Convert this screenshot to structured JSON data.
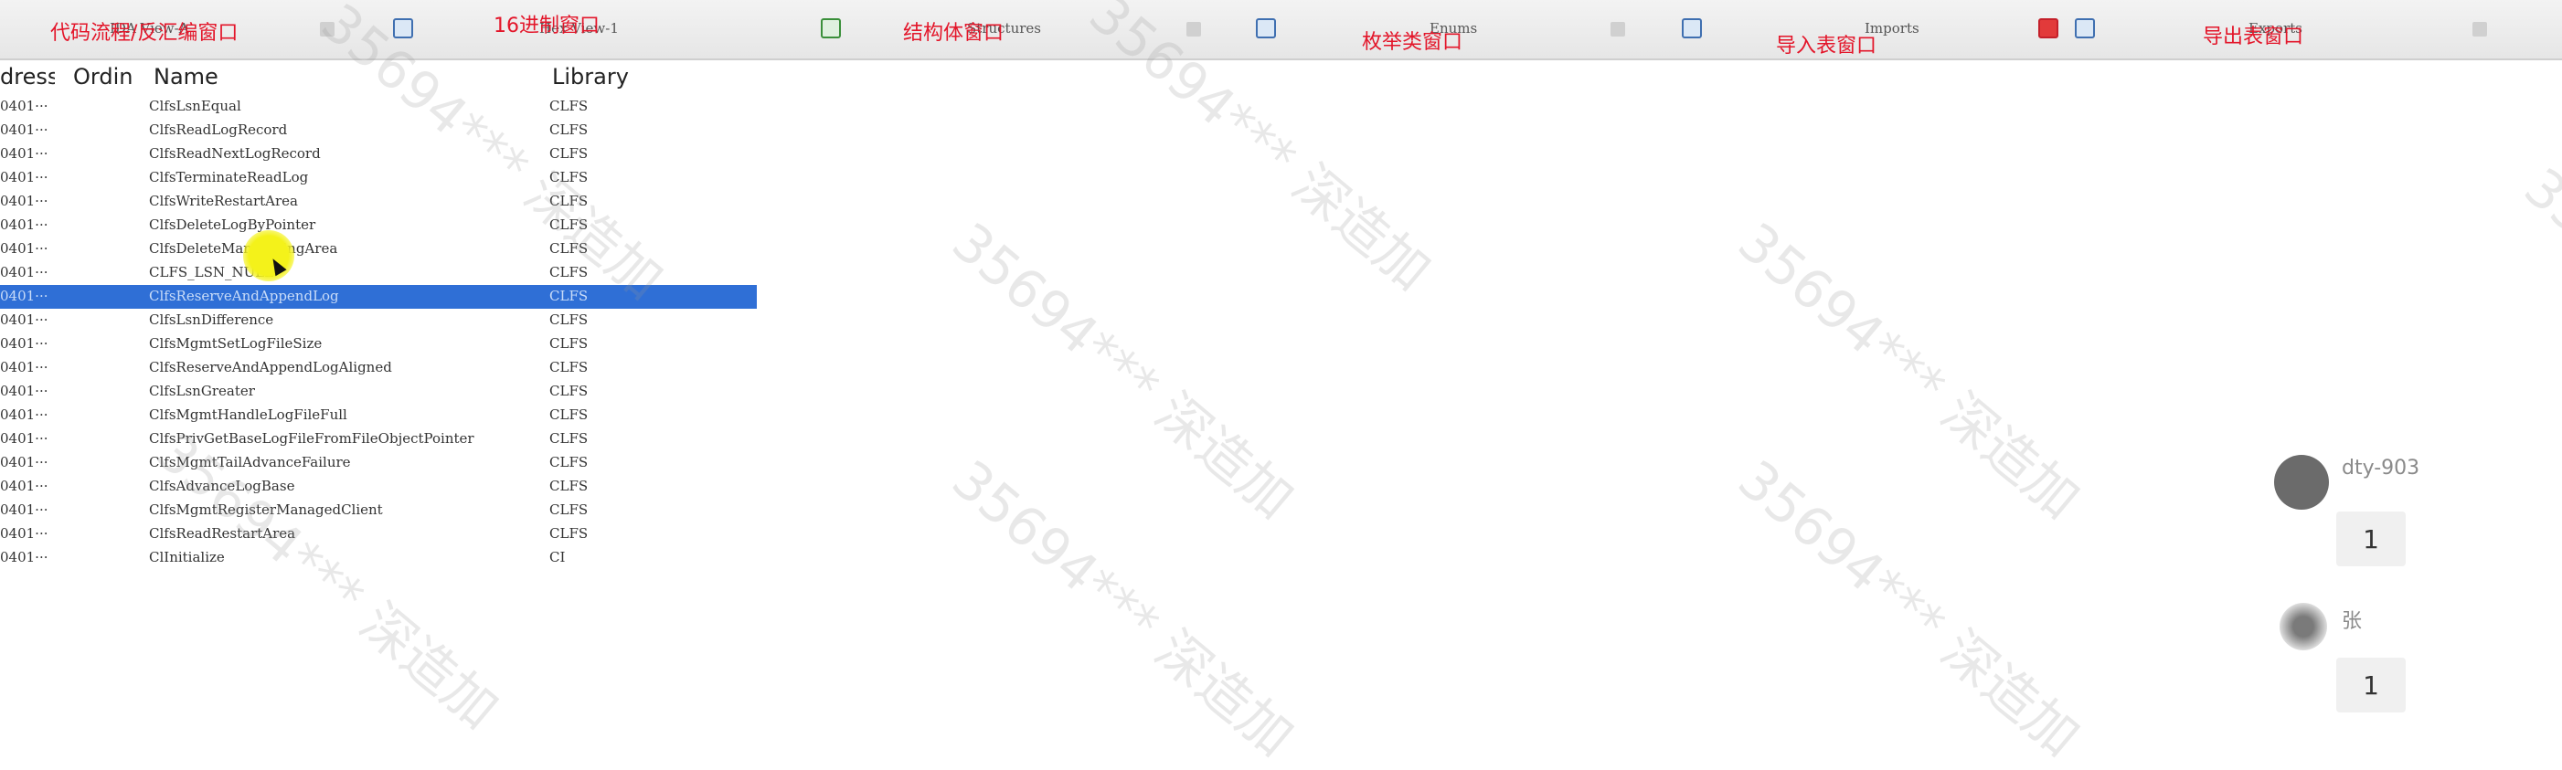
{
  "annotations": [
    "代码流程/反汇编窗口",
    "16进制窗口",
    "结构体窗口",
    "枚举类窗口",
    "导入表窗口",
    "导出表窗口"
  ],
  "tabs": [
    {
      "label": "IDA View-A",
      "icon": "code-view-icon"
    },
    {
      "label": "Hex View-1",
      "icon": "hex-view-icon"
    },
    {
      "label": "Structures",
      "icon": "structures-icon"
    },
    {
      "label": "Enums",
      "icon": "enums-icon"
    },
    {
      "label": "Imports",
      "icon": "imports-icon"
    },
    {
      "label": "Exports",
      "icon": "exports-icon"
    }
  ],
  "list": {
    "columns": [
      "dress",
      "Ordin",
      "Name",
      "Library"
    ],
    "rows": [
      {
        "address": "0401···",
        "name": "ClfsLsnEqual",
        "library": "CLFS"
      },
      {
        "address": "0401···",
        "name": "ClfsReadLogRecord",
        "library": "CLFS"
      },
      {
        "address": "0401···",
        "name": "ClfsReadNextLogRecord",
        "library": "CLFS"
      },
      {
        "address": "0401···",
        "name": "ClfsTerminateReadLog",
        "library": "CLFS"
      },
      {
        "address": "0401···",
        "name": "ClfsWriteRestartArea",
        "library": "CLFS"
      },
      {
        "address": "0401···",
        "name": "ClfsDeleteLogByPointer",
        "library": "CLFS"
      },
      {
        "address": "0401···",
        "name": "ClfsDeleteMarshallingArea",
        "library": "CLFS"
      },
      {
        "address": "0401···",
        "name": "CLFS_LSN_NULL",
        "library": "CLFS"
      },
      {
        "address": "0401···",
        "name": "ClfsReserveAndAppendLog",
        "library": "CLFS"
      },
      {
        "address": "0401···",
        "name": "ClfsLsnDifference",
        "library": "CLFS"
      },
      {
        "address": "0401···",
        "name": "ClfsMgmtSetLogFileSize",
        "library": "CLFS"
      },
      {
        "address": "0401···",
        "name": "ClfsReserveAndAppendLogAligned",
        "library": "CLFS"
      },
      {
        "address": "0401···",
        "name": "ClfsLsnGreater",
        "library": "CLFS"
      },
      {
        "address": "0401···",
        "name": "ClfsMgmtHandleLogFileFull",
        "library": "CLFS"
      },
      {
        "address": "0401···",
        "name": "ClfsPrivGetBaseLogFileFromFileObjectPointer",
        "library": "CLFS"
      },
      {
        "address": "0401···",
        "name": "ClfsMgmtTailAdvanceFailure",
        "library": "CLFS"
      },
      {
        "address": "0401···",
        "name": "ClfsAdvanceLogBase",
        "library": "CLFS"
      },
      {
        "address": "0401···",
        "name": "ClfsMgmtRegisterManagedClient",
        "library": "CLFS"
      },
      {
        "address": "0401···",
        "name": "ClfsReadRestartArea",
        "library": "CLFS"
      },
      {
        "address": "0401···",
        "name": "ClInitialize",
        "library": "CI"
      }
    ],
    "selected_index": 8
  },
  "watermark": "35694*** 深造加",
  "comments": [
    {
      "user": "dty-903",
      "count": "1"
    },
    {
      "user": "张",
      "count": "1"
    }
  ],
  "colors": {
    "selection": "#2f6fd6",
    "annotation": "#e3162a",
    "cursor_highlight": "#f4f21a"
  }
}
